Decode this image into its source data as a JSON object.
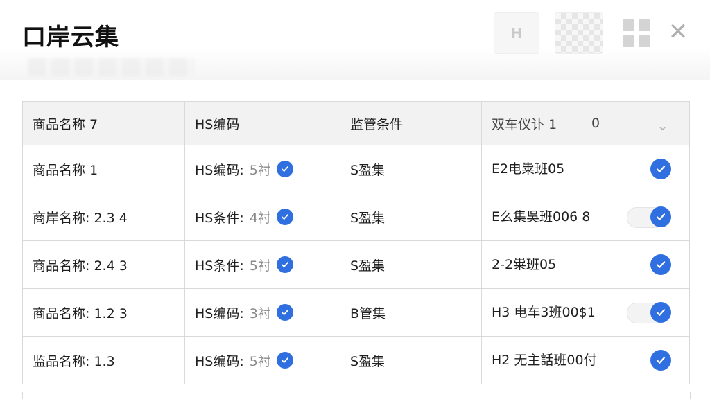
{
  "app": {
    "title": "口岸云集"
  },
  "toolbar": {
    "button_label": "H",
    "close_glyph": "✕"
  },
  "table": {
    "headers": [
      "商品名称 7",
      "HS编码",
      "监管条件",
      "双车仪讣 1",
      "0"
    ],
    "rows": [
      {
        "name": "商品名称 1",
        "hs": "HS编码:",
        "hs_suffix": "5衬",
        "cond": "S盈集",
        "code": "E2电粜班05",
        "toggle": false
      },
      {
        "name": "商岸名称: 2.3  4",
        "hs": "HS条件:",
        "hs_suffix": "4衬",
        "cond": "S盈集",
        "code": "E么集吳班006 8",
        "toggle": true
      },
      {
        "name": "商品名称: 2.4  3",
        "hs": "HS条件:",
        "hs_suffix": "5衬",
        "cond": "S盈集",
        "code": "2-2粜班05",
        "toggle": false
      },
      {
        "name": "商品名称: 1.2  3",
        "hs": "HS编码:",
        "hs_suffix": "3衬",
        "cond": "B管集",
        "code": "H3 电车3班00$1",
        "toggle": true
      },
      {
        "name": "监品名称: 1.3",
        "hs": "HS编码:",
        "hs_suffix": "5衬",
        "cond": "S盈集",
        "code": "H2 无主話班00付",
        "toggle": false
      }
    ]
  },
  "icons": {
    "check": "check-circle-icon",
    "close": "close-icon",
    "grid": "grid-icon",
    "sort": "chevron-down-icon"
  },
  "colors": {
    "accent": "#2f6fe0",
    "header_bg": "#f2f2f2",
    "border": "#d9d9d9"
  }
}
